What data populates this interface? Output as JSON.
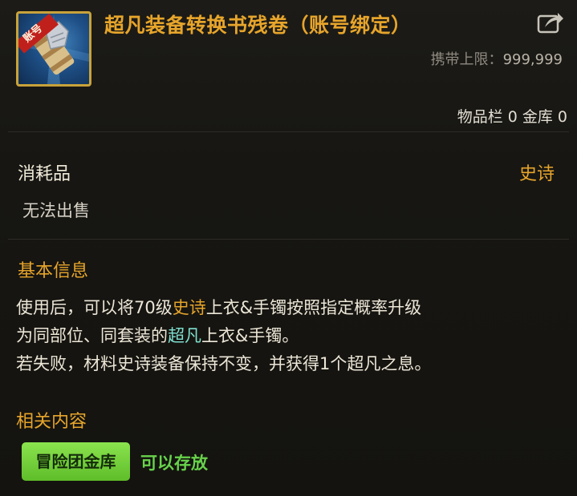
{
  "item": {
    "title": "超凡装备转换书残卷（账号绑定）",
    "icon_badge": "账号",
    "icon": "scroll-item-icon",
    "carry_limit_label": "携带上限：",
    "carry_limit_value": "999,999",
    "storage_counts": "物品栏 0 金库 0"
  },
  "category": {
    "type": "消耗品",
    "rarity": "史诗",
    "trade": "无法出售"
  },
  "basic_info": {
    "title": "基本信息",
    "line1_a": "使用后，可以将70级",
    "line1_epic": "史诗",
    "line1_b": "上衣&手镯按照指定概率升级",
    "line2_a": "为同部位、同套装的",
    "line2_legend": "超凡",
    "line2_b": "上衣&手镯。",
    "line3": "若失败，材料史诗装备保持不变，并获得1个超凡之息。"
  },
  "related": {
    "title": "相关内容",
    "button_label": "冒险团金库",
    "status": "可以存放"
  },
  "colors": {
    "gold": "#e7a52b",
    "legendary_teal": "#7fe0d0",
    "green": "#67d34b"
  }
}
